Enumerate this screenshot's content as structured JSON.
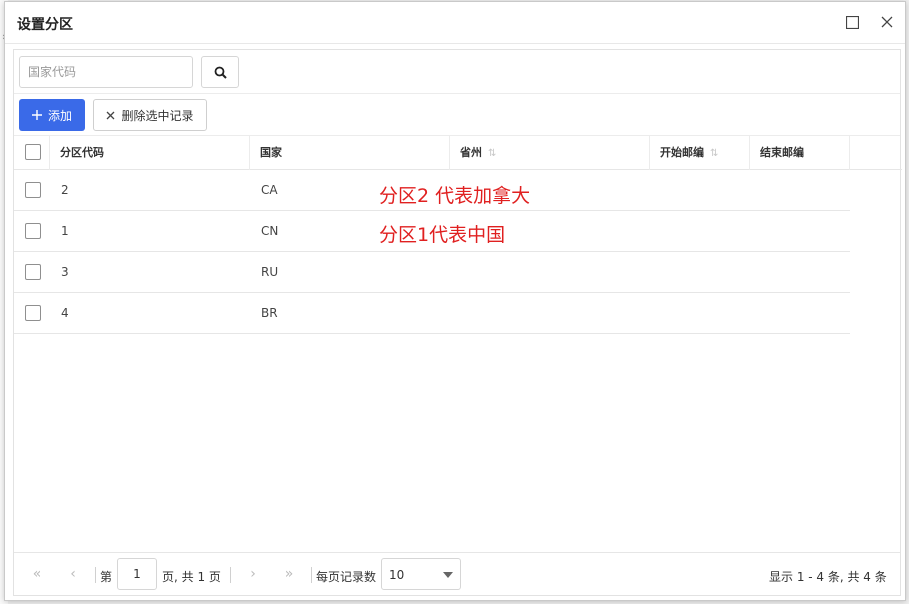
{
  "dialog": {
    "title": "设置分区"
  },
  "search": {
    "placeholder": "国家代码",
    "value": ""
  },
  "actions": {
    "add_label": "添加",
    "delete_label": "删除选中记录"
  },
  "table": {
    "columns": [
      {
        "label": "分区代码",
        "sortable": false
      },
      {
        "label": "国家",
        "sortable": false
      },
      {
        "label": "省州",
        "sortable": true
      },
      {
        "label": "开始邮编",
        "sortable": true
      },
      {
        "label": "结束邮编",
        "sortable": false
      }
    ],
    "rows": [
      {
        "code": "2",
        "country": "CA"
      },
      {
        "code": "1",
        "country": "CN"
      },
      {
        "code": "3",
        "country": "RU"
      },
      {
        "code": "4",
        "country": "BR"
      }
    ]
  },
  "annotations": [
    "分区2 代表加拿大",
    "分区1代表中国"
  ],
  "pager": {
    "page_prefix": "第",
    "current_page": "1",
    "page_suffix": "页, 共 1 页",
    "per_page_label": "每页记录数",
    "per_page_value": "10",
    "summary": "显示 1 - 4 条, 共 4 条"
  },
  "colors": {
    "primary": "#3a6ae8",
    "annotation": "#e02020"
  }
}
